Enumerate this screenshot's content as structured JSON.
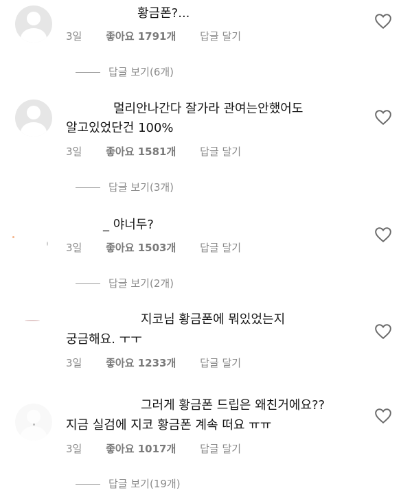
{
  "comments": [
    {
      "text_line1": "황금폰?...",
      "text_line2": "",
      "age": "3일",
      "likes": "좋아요 1791개",
      "reply": "답글 달기",
      "view_replies": "답글 보기(6개)"
    },
    {
      "text_line1": "멀리안나간다 잘가라 관여는안했어도",
      "text_line2": "알고있었단건 100%",
      "age": "3일",
      "likes": "좋아요 1581개",
      "reply": "답글 달기",
      "view_replies": "답글 보기(3개)"
    },
    {
      "text_line1": "야너두?",
      "text_line2": "",
      "age": "3일",
      "likes": "좋아요 1503개",
      "reply": "답글 달기",
      "view_replies": "답글 보기(2개)"
    },
    {
      "text_line1": "지코님 황금폰에 뭐있었는지",
      "text_line2": "궁금해요. ㅜㅜ",
      "age": "3일",
      "likes": "좋아요 1233개",
      "reply": "답글 달기",
      "view_replies": ""
    },
    {
      "text_line1": "그러게 황금폰 드립은 왜친거에요??",
      "text_line2": "지금 실검에 지코 황금폰 계속 떠요 ㅠㅠ",
      "age": "3일",
      "likes": "좋아요 1017개",
      "reply": "답글 달기",
      "view_replies": "답글 보기(19개)"
    }
  ],
  "icons": {
    "like": "heart-outline-icon",
    "avatar": "default-avatar-icon"
  },
  "colors": {
    "meta_text": "#8a8a8a",
    "comment_text": "#151515"
  }
}
